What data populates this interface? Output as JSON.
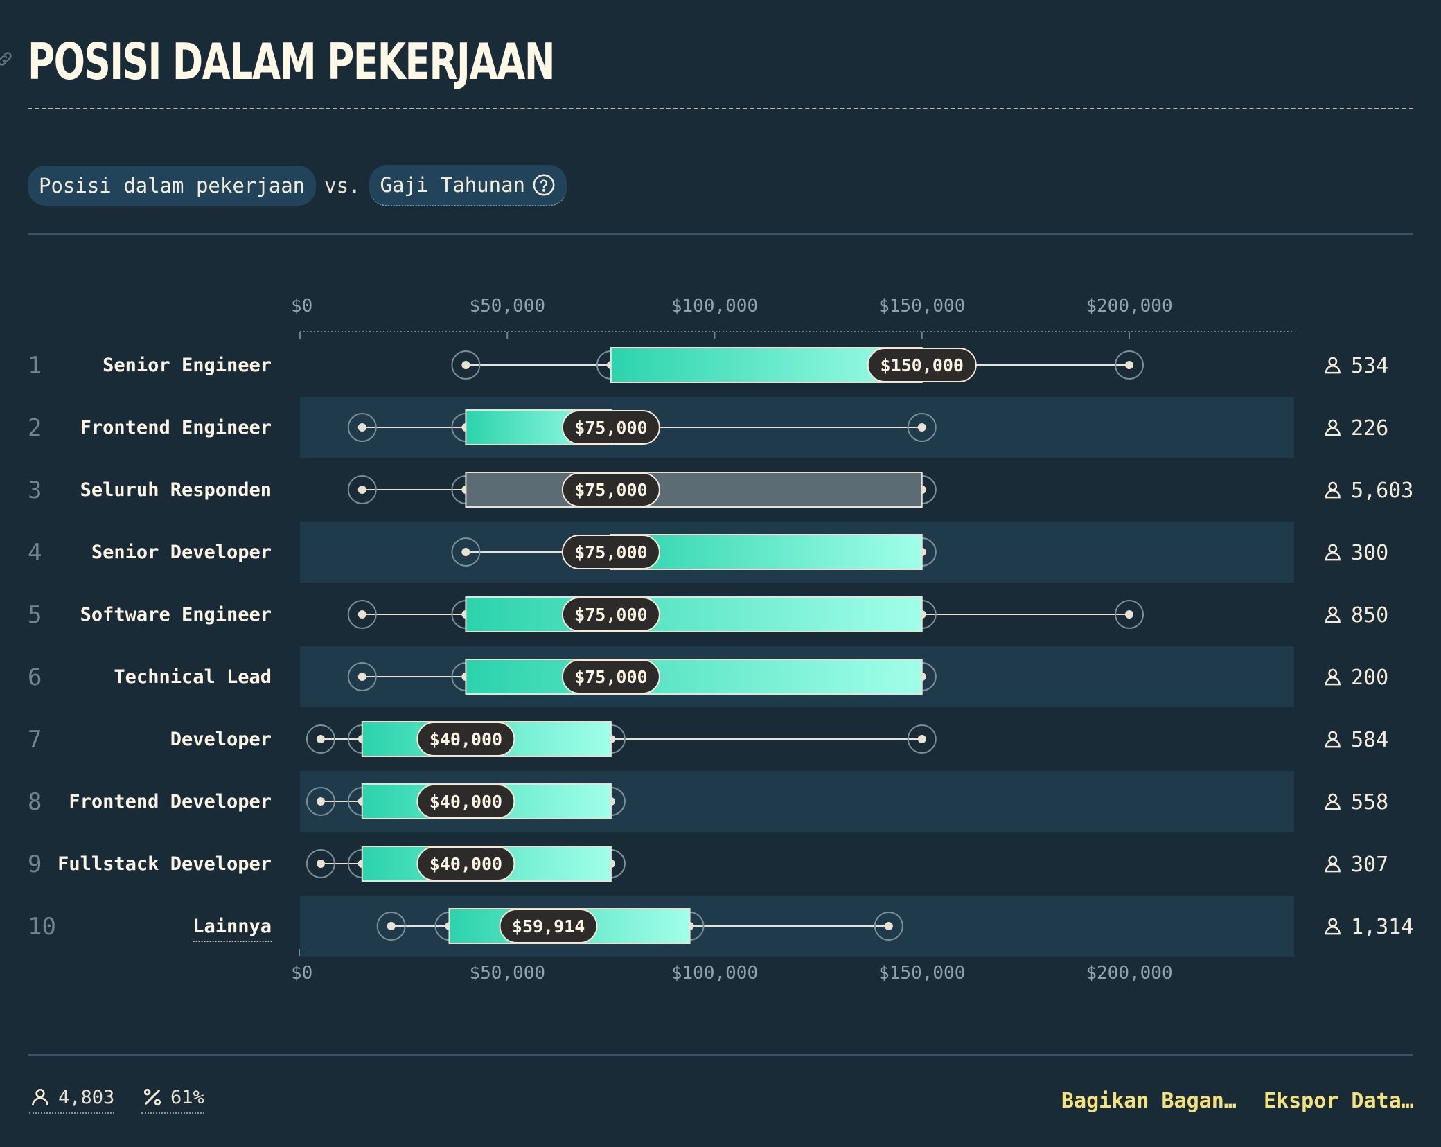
{
  "page": {
    "title": "POSISI DALAM PEKERJAAN"
  },
  "comparison": {
    "left": "Posisi dalam pekerjaan",
    "vs": "vs.",
    "right": "Gaji Tahunan"
  },
  "colors": {
    "background": "#192b36",
    "band": "#1f3a4b",
    "bar_start": "#2bd3ac",
    "bar_end": "#a1ffe9",
    "overall_bar": "#5b6c74",
    "label_bg": "#2d2b29",
    "accent_link": "#f6e27a"
  },
  "chart_data": {
    "type": "boxplot",
    "x_axis": {
      "min": 0,
      "max": 240000,
      "ticks": [
        0,
        50000,
        100000,
        150000,
        200000
      ],
      "tick_labels": [
        "$0",
        "$50,000",
        "$100,000",
        "$150,000",
        "$200,000"
      ]
    },
    "rows": [
      {
        "rank": "1",
        "label": "Senior Engineer",
        "p10": 40000,
        "p25": 75000,
        "median": 150000,
        "p75": 150000,
        "p90": 200000,
        "median_label": "$150,000",
        "count": "534"
      },
      {
        "rank": "2",
        "label": "Frontend Engineer",
        "p10": 15000,
        "p25": 40000,
        "median": 75000,
        "p75": 75000,
        "p90": 150000,
        "median_label": "$75,000",
        "count": "226"
      },
      {
        "rank": "3",
        "label": "Seluruh Responden",
        "p10": 15000,
        "p25": 40000,
        "median": 75000,
        "p75": 150000,
        "p90": 150000,
        "median_label": "$75,000",
        "count": "5,603",
        "overall": true
      },
      {
        "rank": "4",
        "label": "Senior Developer",
        "p10": 40000,
        "p25": 75000,
        "median": 75000,
        "p75": 150000,
        "p90": 150000,
        "median_label": "$75,000",
        "count": "300"
      },
      {
        "rank": "5",
        "label": "Software Engineer",
        "p10": 15000,
        "p25": 40000,
        "median": 75000,
        "p75": 150000,
        "p90": 200000,
        "median_label": "$75,000",
        "count": "850"
      },
      {
        "rank": "6",
        "label": "Technical Lead",
        "p10": 15000,
        "p25": 40000,
        "median": 75000,
        "p75": 150000,
        "p90": 150000,
        "median_label": "$75,000",
        "count": "200"
      },
      {
        "rank": "7",
        "label": "Developer",
        "p10": 5000,
        "p25": 15000,
        "median": 40000,
        "p75": 75000,
        "p90": 150000,
        "median_label": "$40,000",
        "count": "584"
      },
      {
        "rank": "8",
        "label": "Frontend Developer",
        "p10": 5000,
        "p25": 15000,
        "median": 40000,
        "p75": 75000,
        "p90": 75000,
        "median_label": "$40,000",
        "count": "558"
      },
      {
        "rank": "9",
        "label": "Fullstack Developer",
        "p10": 5000,
        "p25": 15000,
        "median": 40000,
        "p75": 75000,
        "p90": 75000,
        "median_label": "$40,000",
        "count": "307"
      },
      {
        "rank": "10",
        "label": "Lainnya",
        "p10": 22000,
        "p25": 36000,
        "median": 59914,
        "p75": 94000,
        "p90": 142000,
        "median_label": "$59,914",
        "count": "1,314",
        "link": true
      }
    ]
  },
  "footer": {
    "respondents": "4,803",
    "percent": "61%",
    "share_label": "Bagikan Bagan…",
    "export_label": "Ekspor Data…"
  }
}
